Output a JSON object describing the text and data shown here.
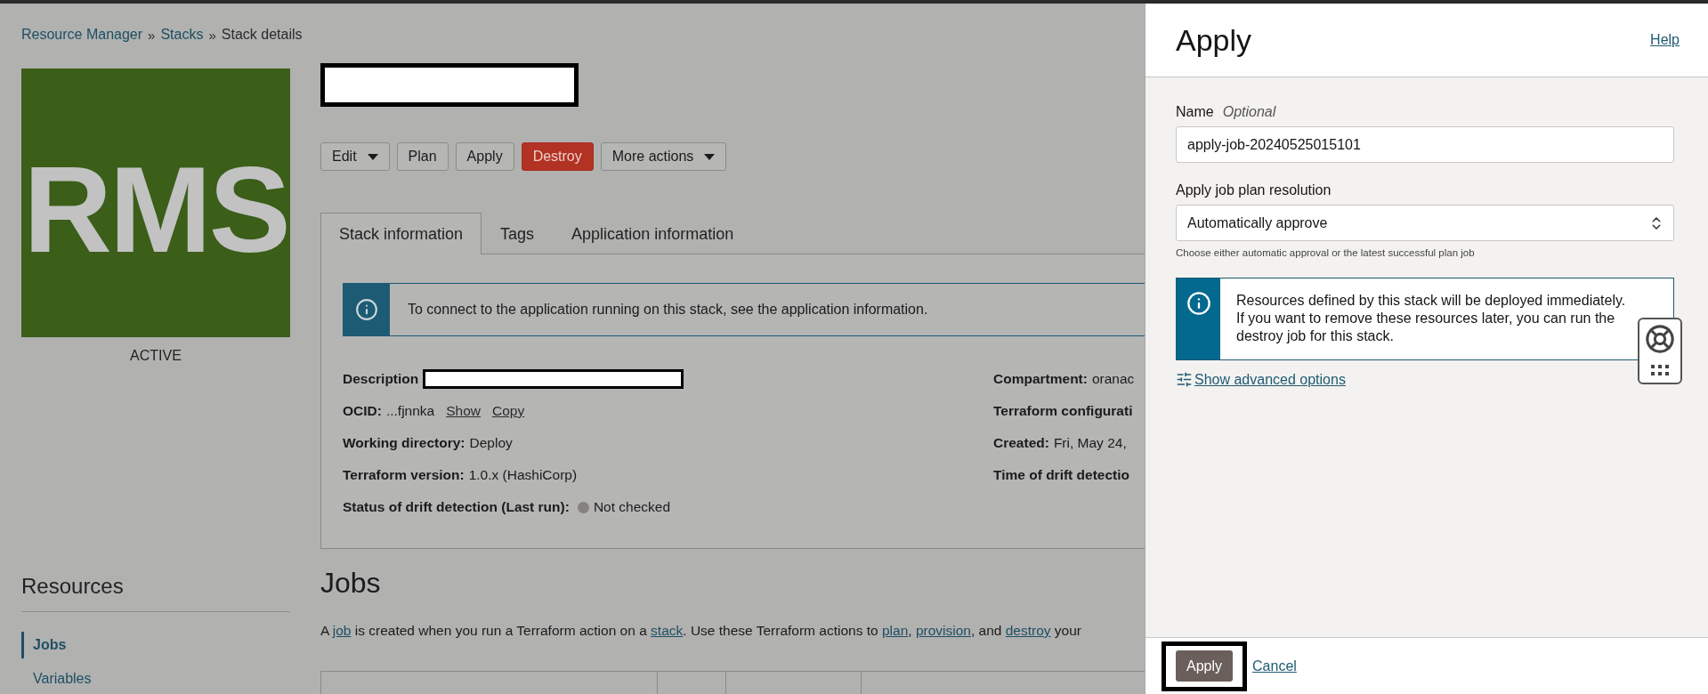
{
  "breadcrumb": {
    "separator": "»",
    "items": [
      {
        "label": "Resource Manager",
        "link": true
      },
      {
        "label": "Stacks",
        "link": true
      },
      {
        "label": "Stack details",
        "link": false
      }
    ]
  },
  "logo": {
    "text": "RMS",
    "status": "ACTIVE"
  },
  "actions": [
    {
      "label": "Edit",
      "kind": "menu"
    },
    {
      "label": "Plan",
      "kind": "plain"
    },
    {
      "label": "Apply",
      "kind": "plain"
    },
    {
      "label": "Destroy",
      "kind": "danger"
    },
    {
      "label": "More actions",
      "kind": "menu"
    }
  ],
  "tabs": [
    {
      "label": "Stack information",
      "selected": true
    },
    {
      "label": "Tags",
      "selected": false
    },
    {
      "label": "Application information",
      "selected": false
    }
  ],
  "banner": "To connect to the application running on this stack, see the application information.",
  "details_left": [
    {
      "kind": "redacted",
      "label": "Description"
    },
    {
      "kind": "ocid",
      "label": "OCID:",
      "value": "...fjnnka",
      "links": [
        "Show",
        "Copy"
      ]
    },
    {
      "kind": "text",
      "label": "Working directory:",
      "value": "Deploy"
    },
    {
      "kind": "text",
      "label": "Terraform version:",
      "value": "1.0.x (HashiCorp)"
    },
    {
      "kind": "status",
      "label": "Status of drift detection (Last run):",
      "value": "Not checked",
      "color": "#858280"
    }
  ],
  "details_right": [
    {
      "label": "Compartment:",
      "value": "oranac"
    },
    {
      "label": "Terraform configurati"
    },
    {
      "label": "Created:",
      "value": "Fri, May 24,"
    },
    {
      "label": "Time of drift detectio"
    }
  ],
  "resources": {
    "title": "Resources",
    "items": [
      {
        "label": "Jobs",
        "selected": true
      },
      {
        "label": "Variables",
        "selected": false
      }
    ]
  },
  "jobs": {
    "title": "Jobs",
    "intro": [
      {
        "text": "A "
      },
      {
        "text": "job",
        "link": true
      },
      {
        "text": " is created when you run a Terraform action on a "
      },
      {
        "text": "stack",
        "link": true
      },
      {
        "text": ". Use these Terraform actions to "
      },
      {
        "text": "plan",
        "link": true
      },
      {
        "text": ", "
      },
      {
        "text": "provision",
        "link": true
      },
      {
        "text": ", and "
      },
      {
        "text": "destroy",
        "link": true
      },
      {
        "text": " your"
      }
    ]
  },
  "panel": {
    "title": "Apply",
    "help": "Help",
    "name_label": "Name",
    "name_optional": "Optional",
    "name_value": "apply-job-20240525015101",
    "resolution_label": "Apply job plan resolution",
    "resolution_value": "Automatically approve",
    "resolution_hint": "Choose either automatic approval or the latest successful plan job",
    "notice": "Resources defined by this stack will be deployed immediately. If you want to remove these resources later, you can run the destroy job for this stack.",
    "advanced": "Show advanced options",
    "submit": "Apply",
    "cancel": "Cancel"
  }
}
